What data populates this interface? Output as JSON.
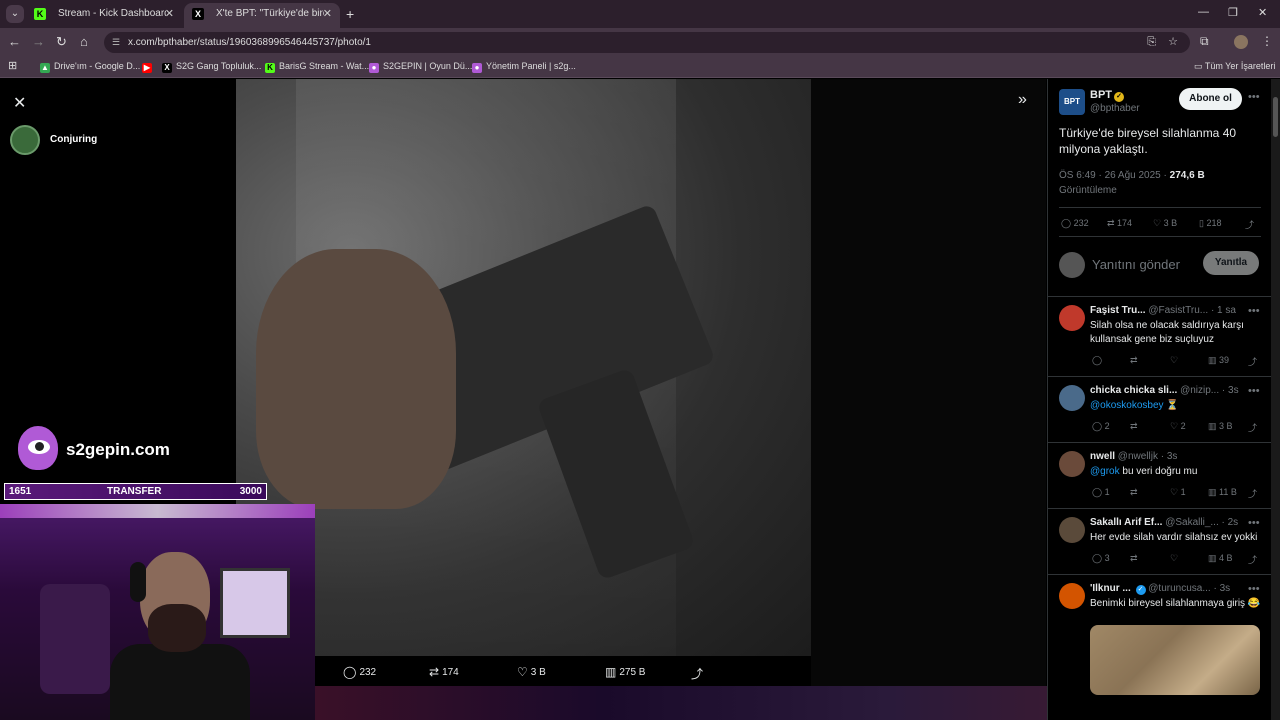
{
  "browser": {
    "tabs": [
      {
        "label": "Stream - Kick Dashboard",
        "favicon": "K",
        "favicon_color": "#53fc18",
        "active": false
      },
      {
        "label": "X'te BPT: \"Türkiye'de bireysel si",
        "favicon": "X",
        "favicon_color": "#000000",
        "active": true
      }
    ],
    "url": "x.com/bpthaber/status/1960368996546445737/photo/1",
    "bookmarks": [
      {
        "label": "Drive'ım - Google D...",
        "icon_color": "#34a853",
        "icon": "▲"
      },
      {
        "label": "",
        "icon_color": "#ff0000",
        "icon": "▶"
      },
      {
        "label": "S2G Gang Topluluk...",
        "icon_color": "#000000",
        "icon": "X"
      },
      {
        "label": "BarisG Stream - Wat...",
        "icon_color": "#53fc18",
        "icon": "K"
      },
      {
        "label": "S2GEPIN | Oyun Dü...",
        "icon_color": "#b05ad6",
        "icon": "●"
      },
      {
        "label": "Yönetim Paneli | s2g...",
        "icon_color": "#b05ad6",
        "icon": "●"
      }
    ],
    "all_bookmarks": "Tüm Yer İşaretleri"
  },
  "overlay": {
    "username": "Conjuring",
    "brand": "s2gepin.com",
    "transfer": {
      "left": "1651",
      "label": "TRANSFER",
      "right": "3000"
    }
  },
  "tweet": {
    "author_name": "BPT",
    "author_avatar_text": "BPT",
    "author_handle": "@bpthaber",
    "follow_label": "Abone ol",
    "text": "Türkiye'de bireysel silahlanma 40 milyona yaklaştı.",
    "time": "ÖS 6:49 · 26 Ağu 2025 · ",
    "views": "274,6 B",
    "views_label": "Görüntüleme",
    "stats": {
      "replies": "232",
      "retweets": "174",
      "likes": "3 B",
      "bookmarks": "218"
    },
    "reply_placeholder": "Yanıtını gönder",
    "reply_button": "Yanıtla"
  },
  "photo_bar": {
    "replies": "232",
    "retweets": "174",
    "likes": "3 B",
    "views": "275 B"
  },
  "replies": [
    {
      "name": "Faşist Tru...",
      "handle": "@FasistTru...",
      "time": "· 1 sa",
      "text": "Silah olsa ne olacak saldırıya karşı kullansak gene biz suçluyuz",
      "mention": "",
      "replies": "",
      "retweets": "",
      "likes": "",
      "views": "39",
      "avatar_color": "#c0392b"
    },
    {
      "name": "chicka chicka sli...",
      "handle": "@nizip...",
      "time": "· 3s",
      "text": " ⏳",
      "mention": "@okoskokosbey",
      "replies": "2",
      "retweets": "",
      "likes": "2",
      "views": "3 B",
      "avatar_color": "#4a6a8a"
    },
    {
      "name": "nwell",
      "handle": "@nwelljk",
      "time": "· 3s",
      "text": " bu veri doğru mu",
      "mention": "@grok",
      "replies": "1",
      "retweets": "",
      "likes": "1",
      "views": "11 B",
      "avatar_color": "#6a4a3a"
    },
    {
      "name": "Sakallı Arif Ef...",
      "handle": "@Sakalli_...",
      "time": "· 2s",
      "text": "Her evde silah vardır silahsız ev yokki",
      "mention": "",
      "replies": "3",
      "retweets": "",
      "likes": "",
      "views": "4 B",
      "avatar_color": "#5a4a3a"
    },
    {
      "name": "'Ilknur ...",
      "handle": "@turuncusa...",
      "time": "· 3s",
      "text": "Benimki bireysel silahlanmaya giriş 😂",
      "mention": "",
      "replies": "",
      "retweets": "",
      "likes": "",
      "views": "",
      "avatar_color": "#d35400"
    }
  ],
  "icons": {
    "close": "✕",
    "expand": "»",
    "reply": "💬",
    "retweet": "⇄",
    "like": "♡",
    "views": "📊",
    "share": "⤴",
    "bookmark": "🔖"
  }
}
